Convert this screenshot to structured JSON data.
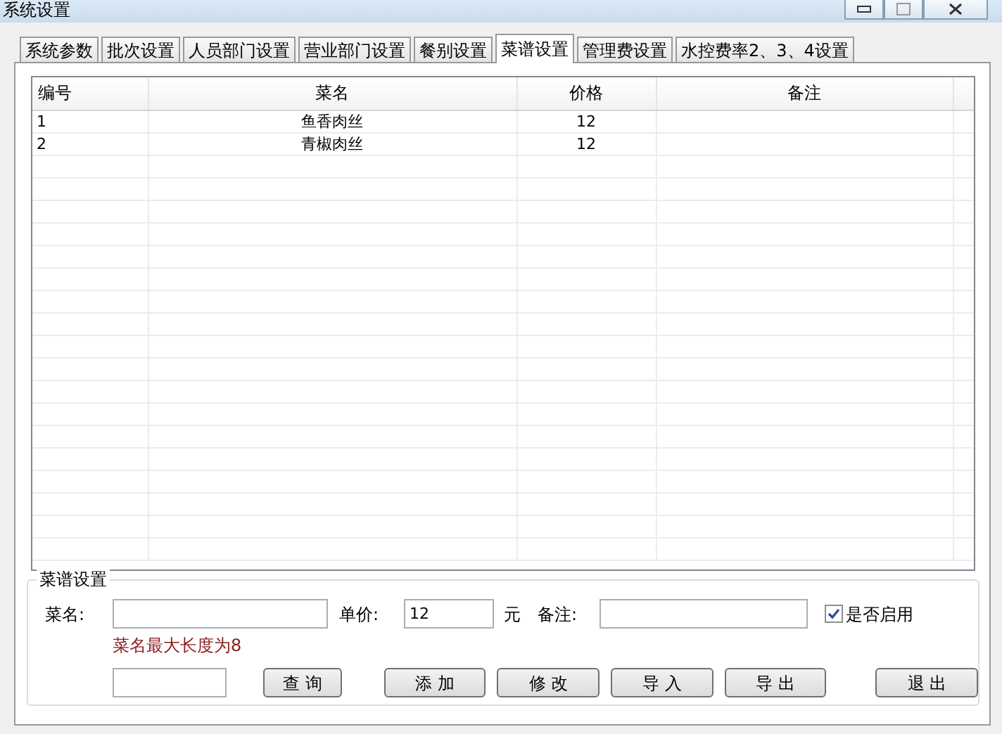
{
  "window": {
    "title": "系统设置"
  },
  "tabs": [
    {
      "label": "系统参数",
      "selected": false
    },
    {
      "label": "批次设置",
      "selected": false
    },
    {
      "label": "人员部门设置",
      "selected": false
    },
    {
      "label": "营业部门设置",
      "selected": false
    },
    {
      "label": "餐别设置",
      "selected": false
    },
    {
      "label": "菜谱设置",
      "selected": true
    },
    {
      "label": "管理费设置",
      "selected": false
    },
    {
      "label": "水控费率2、3、4设置",
      "selected": false
    }
  ],
  "table": {
    "columns": [
      "编号",
      "菜名",
      "价格",
      "备注"
    ],
    "rows": [
      [
        "1",
        "鱼香肉丝",
        "12",
        null
      ],
      [
        "2",
        "青椒肉丝",
        "12",
        null
      ]
    ]
  },
  "form": {
    "title": "菜谱设置",
    "name_label": "菜名:",
    "price_label": "单价:",
    "price_value": "12",
    "unit": "元",
    "note_label": "备注:",
    "enabled": {
      "label": "是否启用",
      "checked": true
    },
    "hint": "菜名最大长度为8",
    "buttons": [
      "查 询",
      "添 加",
      "修 改",
      "导 入",
      "导 出",
      "退 出"
    ]
  }
}
